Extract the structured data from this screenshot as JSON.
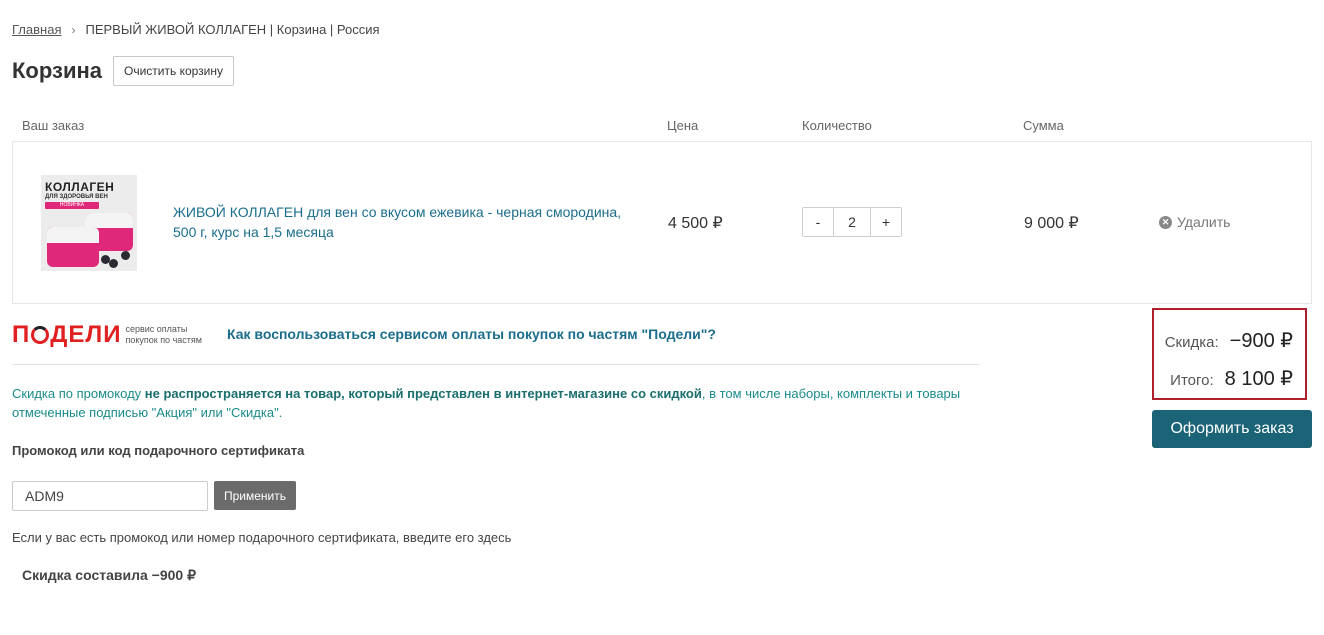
{
  "breadcrumb": {
    "home": "Главная",
    "current": "ПЕРВЫЙ ЖИВОЙ КОЛЛАГЕН | Корзина | Россия"
  },
  "header": {
    "title": "Корзина",
    "clear_label": "Очистить корзину"
  },
  "table": {
    "columns": [
      "Ваш заказ",
      "Цена",
      "Количество",
      "Сумма"
    ]
  },
  "item": {
    "image_text_title": "КОЛЛАГЕН",
    "image_text_sub": "ДЛЯ ЗДОРОВЬЯ ВЕН",
    "image_badge": "НОВИНКА",
    "name": "ЖИВОЙ КОЛЛАГЕН для вен со вкусом ежевика - черная смородина, 500 г, курс на 1,5 месяца",
    "price": "4 500 ₽",
    "qty_minus": "-",
    "qty_value": "2",
    "qty_plus": "+",
    "sum": "9 000 ₽",
    "delete_label": "Удалить"
  },
  "podeli": {
    "logo": "ПОДЕЛИ",
    "sub_line1": "сервис оплаты",
    "sub_line2": "покупок по частям",
    "link": "Как воспользоваться сервисом оплаты покупок по частям \"Подели\"?"
  },
  "promo": {
    "note_part1": "Скидка по промокоду ",
    "note_bold": "не распространяется на товар, который представлен в интернет-магазине со скидкой",
    "note_part2": ", в том числе наборы, комплекты и товары отмеченные подписью \"Акция\" или \"Скидка\".",
    "label": "Промокод или код подарочного сертификата",
    "input_value": "ADM9",
    "apply_label": "Применить",
    "help": "Если у вас есть промокод или номер подарочного сертификата, введите его здесь",
    "discount_msg": "Скидка составила −900 ₽"
  },
  "totals": {
    "discount_label": "Скидка:",
    "discount_value": "−900 ₽",
    "total_label": "Итого:",
    "total_value": "8 100 ₽"
  },
  "order_label": "Оформить заказ",
  "colors": {
    "link": "#1a6e8c",
    "accent": "#1b6478",
    "highlight_border": "#b0202a",
    "podeli_red": "#e02020"
  }
}
